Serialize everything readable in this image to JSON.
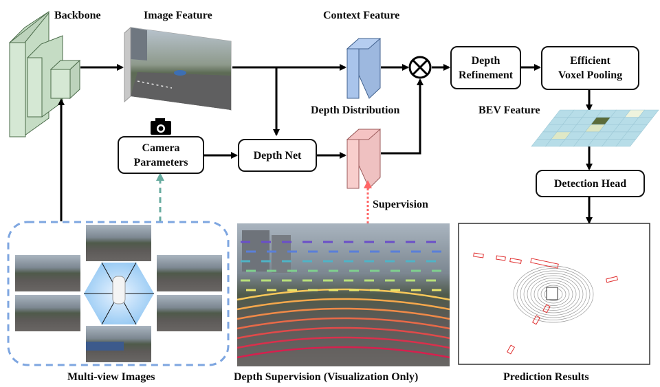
{
  "labels": {
    "backbone": "Backbone",
    "image_feature": "Image Feature",
    "context_feature": "Context Feature",
    "depth_distribution": "Depth Distribution",
    "bev_feature": "BEV Feature",
    "supervision": "Supervision",
    "multi_view_images": "Multi-view Images",
    "depth_supervision": "Depth Supervision (Visualization Only)",
    "prediction_results": "Prediction Results"
  },
  "boxes": {
    "camera_parameters": [
      "Camera",
      "Parameters"
    ],
    "depth_net": [
      "Depth Net"
    ],
    "depth_refinement": [
      "Depth",
      "Refinement"
    ],
    "voxel_pooling": [
      "Efficient",
      "Voxel Pooling"
    ],
    "detection_head": [
      "Detection Head"
    ]
  },
  "icons": {
    "camera": "camera-icon",
    "multiply": "circled-times-icon"
  },
  "colors": {
    "backbone_fill": "#d5e8d4",
    "backbone_stroke": "#4a6b49",
    "context_fill": "#a9c4eb",
    "depth_dist_fill": "#f8cecc",
    "bev_fill": "#b7dde8",
    "camera_arrow": "#67ab9f",
    "supervision_arrow": "#ff6666",
    "multiview_border": "#7ea6e0",
    "pred_box": "#e03030"
  }
}
